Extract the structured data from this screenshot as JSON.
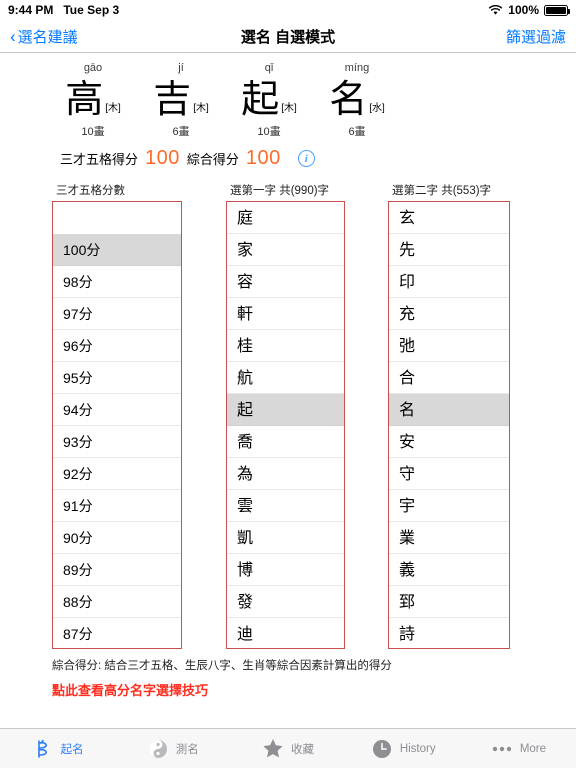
{
  "status_bar": {
    "time": "9:44 PM",
    "date": "Tue Sep 3",
    "battery_percent": "100%",
    "wifi_icon": "wifi-icon",
    "battery_icon": "battery-icon"
  },
  "nav": {
    "back_label": "選名建議",
    "back_chevron": "‹",
    "title": "選名 自選模式",
    "right_label": "篩選過濾"
  },
  "name": {
    "characters": [
      {
        "pinyin": "gāo",
        "char": "高",
        "element": "[木]",
        "strokes": "10畫"
      },
      {
        "pinyin": "jí",
        "char": "吉",
        "element": "[木]",
        "strokes": "6畫"
      },
      {
        "pinyin": "qǐ",
        "char": "起",
        "element": "[木]",
        "strokes": "10畫"
      },
      {
        "pinyin": "míng",
        "char": "名",
        "element": "[水]",
        "strokes": "6畫"
      }
    ]
  },
  "score": {
    "label_1": "三才五格得分",
    "value_1": "100",
    "label_2": "綜合得分",
    "value_2": "100",
    "info_glyph": "i",
    "accent_color": "#ff6a2b"
  },
  "columns": [
    {
      "header": "三才五格分數",
      "selected": "100分",
      "options": [
        "",
        "100分",
        "98分",
        "97分",
        "96分",
        "95分",
        "94分",
        "93分",
        "92分",
        "91分",
        "90分",
        "89分",
        "88分",
        "87分"
      ]
    },
    {
      "header": "選第一字 共(990)字",
      "selected": "起",
      "options": [
        "庭",
        "家",
        "容",
        "軒",
        "桂",
        "航",
        "起",
        "喬",
        "為",
        "雲",
        "凱",
        "博",
        "發",
        "迪"
      ]
    },
    {
      "header": "選第二字 共(553)字",
      "selected": "名",
      "options": [
        "玄",
        "先",
        "印",
        "充",
        "弛",
        "合",
        "名",
        "安",
        "守",
        "宇",
        "業",
        "義",
        "郅",
        "詩"
      ]
    }
  ],
  "notes": {
    "description": "綜合得分: 結合三才五格、生辰八字、生肖等綜合因素計算出的得分",
    "link": "點此查看高分名字選擇技巧",
    "link_color": "#ff2d1f"
  },
  "tabbar": {
    "items": [
      {
        "label": "起名",
        "icon": "naming-icon",
        "active": true
      },
      {
        "label": "測名",
        "icon": "yinyang-icon",
        "active": false
      },
      {
        "label": "收藏",
        "icon": "star-icon",
        "active": false
      },
      {
        "label": "History",
        "icon": "clock-icon",
        "active": false
      },
      {
        "label": "More",
        "icon": "ellipsis-icon",
        "active": false
      }
    ]
  }
}
